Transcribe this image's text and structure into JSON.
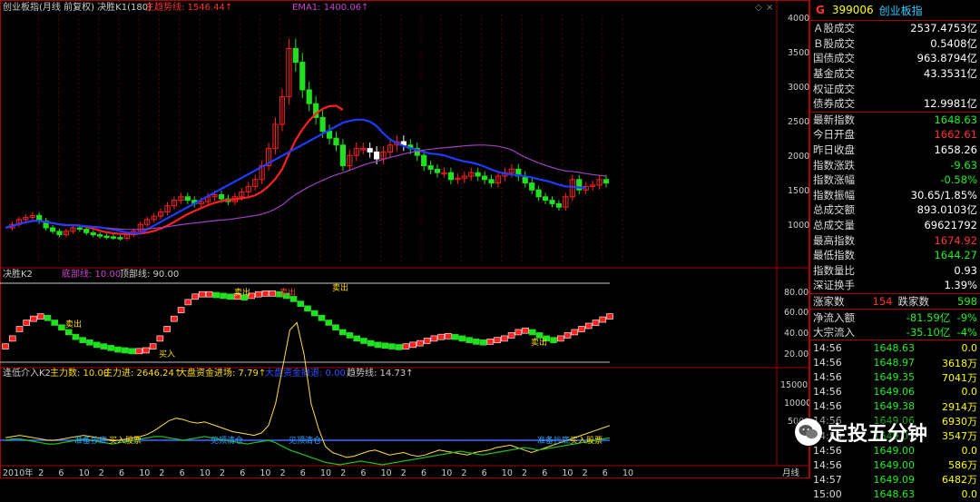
{
  "main_chart": {
    "title": "创业板指(月线 前复权) 决胜K1(180)",
    "trend_label": "主趋势线: 1546.44↑",
    "ema_label": "EMA1: 1400.06↑",
    "y_ticks": [
      "4000",
      "3500",
      "3000",
      "2500",
      "2000",
      "1500",
      "1000"
    ]
  },
  "k2_panel": {
    "title": "决胜K2",
    "bottom_line": "底部线: 10.00",
    "top_line": "顶部线: 90.00",
    "y_ticks": [
      "80.00",
      "60.00",
      "40.00",
      "20.00"
    ],
    "annotations": [
      "卖出",
      "卖出",
      "卖出",
      "卖出",
      "卖出",
      "买入"
    ]
  },
  "k3_panel": {
    "title": "逢低介入K2",
    "main_label": "主力数: 10.00",
    "main_in": "主力进: 2646.24↑",
    "big_in": "大盘资金进场: 7.79↑",
    "big_out": "大盘资金撤退: 0.00",
    "trend": "趋势线: 14.73↑",
    "y_ticks": [
      "15000",
      "10000",
      "5000"
    ],
    "annotations": [
      "准备抄底",
      "买入股票",
      "见顶清仓",
      "见顶清仓",
      "准备抄底",
      "买入股票"
    ]
  },
  "x_axis": {
    "labels": [
      "2010年",
      "2",
      "6",
      "10",
      "2",
      "6",
      "10",
      "2",
      "6",
      "10",
      "2",
      "6",
      "10",
      "2",
      "6",
      "10",
      "2",
      "6",
      "10",
      "2",
      "6",
      "10",
      "2",
      "6",
      "10",
      "2",
      "6",
      "10",
      "2",
      "6",
      "10"
    ],
    "period": "月线"
  },
  "colors": {
    "up": "#ff2020",
    "down": "#20e020",
    "ma_red": "#ff2020",
    "ma_blue": "#1e3cff",
    "ema_purple": "#a040c0",
    "border": "#aa0000"
  },
  "panel": {
    "g": "G",
    "code": "399006",
    "name": "创业板指",
    "stats": [
      {
        "k": "Ａ股成交",
        "v": "2537.4753亿",
        "c": "w"
      },
      {
        "k": "Ｂ股成交",
        "v": "0.5408亿",
        "c": "w"
      },
      {
        "k": "国债成交",
        "v": "963.8794亿",
        "c": "w"
      },
      {
        "k": "基金成交",
        "v": "43.3531亿",
        "c": "w"
      },
      {
        "k": "权证成交",
        "v": "",
        "c": "w"
      },
      {
        "k": "债券成交",
        "v": "12.9981亿",
        "c": "w"
      }
    ],
    "quote": [
      {
        "k": "最新指数",
        "v": "1648.63",
        "c": "gr"
      },
      {
        "k": "今日开盘",
        "v": "1662.61",
        "c": "r"
      },
      {
        "k": "昨日收盘",
        "v": "1658.26",
        "c": "w"
      },
      {
        "k": "指数涨跌",
        "v": "-9.63",
        "c": "gr"
      },
      {
        "k": "指数涨幅",
        "v": "-0.58%",
        "c": "gr"
      },
      {
        "k": "指数振幅",
        "v": "30.65/1.85%",
        "c": "w"
      },
      {
        "k": "总成交额",
        "v": "893.0103亿",
        "c": "w"
      },
      {
        "k": "总成交量",
        "v": "69621792",
        "c": "w"
      },
      {
        "k": "最高指数",
        "v": "1674.92",
        "c": "r"
      },
      {
        "k": "最低指数",
        "v": "1644.27",
        "c": "gr"
      },
      {
        "k": "指数量比",
        "v": "0.93",
        "c": "w"
      },
      {
        "k": "深证换手",
        "v": "1.39%",
        "c": "w"
      }
    ],
    "updown": {
      "up_label": "涨家数",
      "up": "154",
      "down_label": "跌家数",
      "down": "598"
    },
    "flows": [
      {
        "k": "净流入额",
        "v": "-81.59亿",
        "p": "-9%"
      },
      {
        "k": "大宗流入",
        "v": "-35.10亿",
        "p": "-4%"
      }
    ],
    "ticks": [
      {
        "t": "14:56",
        "p": "1648.63",
        "v": "0.0"
      },
      {
        "t": "14:56",
        "p": "1648.97",
        "v": "3618万"
      },
      {
        "t": "14:56",
        "p": "1649.35",
        "v": "7041万"
      },
      {
        "t": "14:56",
        "p": "1649.06",
        "v": "0.0"
      },
      {
        "t": "14:56",
        "p": "1649.38",
        "v": "2914万"
      },
      {
        "t": "14:56",
        "p": "1649.06",
        "v": "6930万"
      },
      {
        "t": "14:56",
        "p": "1649.01",
        "v": "3547万"
      },
      {
        "t": "14:56",
        "p": "1649.00",
        "v": "0.0"
      },
      {
        "t": "14:56",
        "p": "1649.00",
        "v": "586万"
      },
      {
        "t": "14:57",
        "p": "1649.09",
        "v": "6482万"
      },
      {
        "t": "15:00",
        "p": "1648.63",
        "v": "0.0"
      }
    ]
  },
  "watermark": "定投五分钟"
}
